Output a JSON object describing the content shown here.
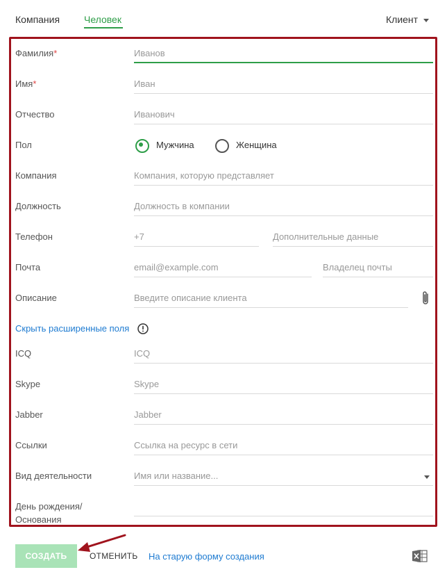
{
  "tabs": {
    "company": "Компания",
    "person": "Человек"
  },
  "client_type": "Клиент",
  "fields": {
    "last_name": {
      "label": "Фамилия",
      "required": "*",
      "placeholder": "Иванов"
    },
    "first_name": {
      "label": "Имя",
      "required": "*",
      "placeholder": "Иван"
    },
    "patronymic": {
      "label": "Отчество",
      "placeholder": "Иванович"
    },
    "gender": {
      "label": "Пол",
      "male": "Мужчина",
      "female": "Женщина",
      "selected": "male"
    },
    "company": {
      "label": "Компания",
      "placeholder": "Компания, которую представляет"
    },
    "position": {
      "label": "Должность",
      "placeholder": "Должность в компании"
    },
    "phone": {
      "label": "Телефон",
      "placeholder": "+7",
      "extra_placeholder": "Дополнительные данные"
    },
    "email": {
      "label": "Почта",
      "placeholder": "email@example.com",
      "owner_placeholder": "Владелец почты"
    },
    "description": {
      "label": "Описание",
      "placeholder": "Введите описание клиента"
    },
    "hide_extended": "Скрыть расширенные поля",
    "icq": {
      "label": "ICQ",
      "placeholder": "ICQ"
    },
    "skype": {
      "label": "Skype",
      "placeholder": "Skype"
    },
    "jabber": {
      "label": "Jabber",
      "placeholder": "Jabber"
    },
    "links": {
      "label": "Ссылки",
      "placeholder": "Ссылка на ресурс в сети"
    },
    "activity": {
      "label": "Вид деятельности",
      "placeholder": "Имя или название..."
    },
    "birthday": {
      "label_line1": "День рождения/",
      "label_line2": "Основания"
    }
  },
  "footer": {
    "create": "СОЗДАТЬ",
    "cancel": "ОТМЕНИТЬ",
    "old_form": "На старую форму создания"
  },
  "colors": {
    "accent": "#2e9e48",
    "frame": "#a0131d",
    "link": "#1e7bd1",
    "required": "#e04646"
  },
  "icons": [
    "chevron-down-icon",
    "radio-icon",
    "paperclip-icon",
    "info-icon",
    "excel-icon",
    "arrow-icon"
  ]
}
